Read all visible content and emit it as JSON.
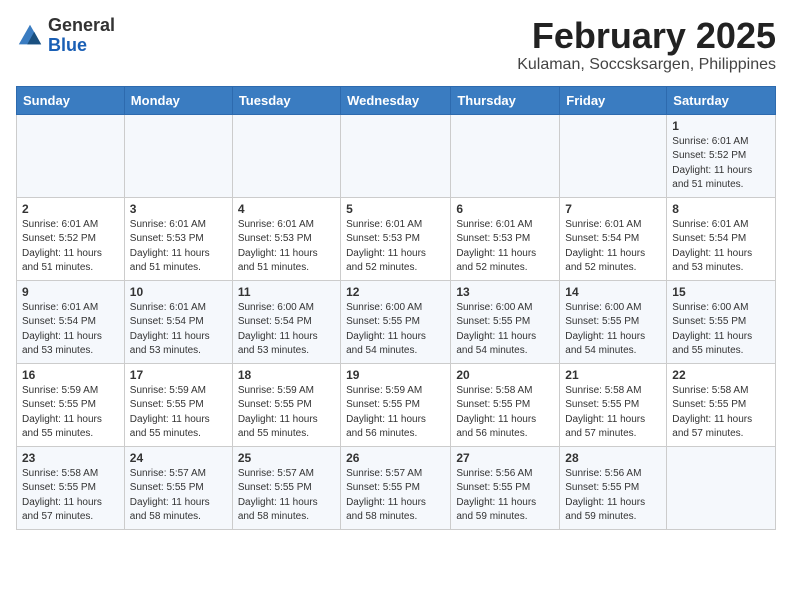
{
  "logo": {
    "general": "General",
    "blue": "Blue"
  },
  "title": "February 2025",
  "subtitle": "Kulaman, Soccsksargen, Philippines",
  "header_days": [
    "Sunday",
    "Monday",
    "Tuesday",
    "Wednesday",
    "Thursday",
    "Friday",
    "Saturday"
  ],
  "weeks": [
    [
      {
        "day": "",
        "info": ""
      },
      {
        "day": "",
        "info": ""
      },
      {
        "day": "",
        "info": ""
      },
      {
        "day": "",
        "info": ""
      },
      {
        "day": "",
        "info": ""
      },
      {
        "day": "",
        "info": ""
      },
      {
        "day": "1",
        "info": "Sunrise: 6:01 AM\nSunset: 5:52 PM\nDaylight: 11 hours and 51 minutes."
      }
    ],
    [
      {
        "day": "2",
        "info": "Sunrise: 6:01 AM\nSunset: 5:52 PM\nDaylight: 11 hours and 51 minutes."
      },
      {
        "day": "3",
        "info": "Sunrise: 6:01 AM\nSunset: 5:53 PM\nDaylight: 11 hours and 51 minutes."
      },
      {
        "day": "4",
        "info": "Sunrise: 6:01 AM\nSunset: 5:53 PM\nDaylight: 11 hours and 51 minutes."
      },
      {
        "day": "5",
        "info": "Sunrise: 6:01 AM\nSunset: 5:53 PM\nDaylight: 11 hours and 52 minutes."
      },
      {
        "day": "6",
        "info": "Sunrise: 6:01 AM\nSunset: 5:53 PM\nDaylight: 11 hours and 52 minutes."
      },
      {
        "day": "7",
        "info": "Sunrise: 6:01 AM\nSunset: 5:54 PM\nDaylight: 11 hours and 52 minutes."
      },
      {
        "day": "8",
        "info": "Sunrise: 6:01 AM\nSunset: 5:54 PM\nDaylight: 11 hours and 53 minutes."
      }
    ],
    [
      {
        "day": "9",
        "info": "Sunrise: 6:01 AM\nSunset: 5:54 PM\nDaylight: 11 hours and 53 minutes."
      },
      {
        "day": "10",
        "info": "Sunrise: 6:01 AM\nSunset: 5:54 PM\nDaylight: 11 hours and 53 minutes."
      },
      {
        "day": "11",
        "info": "Sunrise: 6:00 AM\nSunset: 5:54 PM\nDaylight: 11 hours and 53 minutes."
      },
      {
        "day": "12",
        "info": "Sunrise: 6:00 AM\nSunset: 5:55 PM\nDaylight: 11 hours and 54 minutes."
      },
      {
        "day": "13",
        "info": "Sunrise: 6:00 AM\nSunset: 5:55 PM\nDaylight: 11 hours and 54 minutes."
      },
      {
        "day": "14",
        "info": "Sunrise: 6:00 AM\nSunset: 5:55 PM\nDaylight: 11 hours and 54 minutes."
      },
      {
        "day": "15",
        "info": "Sunrise: 6:00 AM\nSunset: 5:55 PM\nDaylight: 11 hours and 55 minutes."
      }
    ],
    [
      {
        "day": "16",
        "info": "Sunrise: 5:59 AM\nSunset: 5:55 PM\nDaylight: 11 hours and 55 minutes."
      },
      {
        "day": "17",
        "info": "Sunrise: 5:59 AM\nSunset: 5:55 PM\nDaylight: 11 hours and 55 minutes."
      },
      {
        "day": "18",
        "info": "Sunrise: 5:59 AM\nSunset: 5:55 PM\nDaylight: 11 hours and 55 minutes."
      },
      {
        "day": "19",
        "info": "Sunrise: 5:59 AM\nSunset: 5:55 PM\nDaylight: 11 hours and 56 minutes."
      },
      {
        "day": "20",
        "info": "Sunrise: 5:58 AM\nSunset: 5:55 PM\nDaylight: 11 hours and 56 minutes."
      },
      {
        "day": "21",
        "info": "Sunrise: 5:58 AM\nSunset: 5:55 PM\nDaylight: 11 hours and 57 minutes."
      },
      {
        "day": "22",
        "info": "Sunrise: 5:58 AM\nSunset: 5:55 PM\nDaylight: 11 hours and 57 minutes."
      }
    ],
    [
      {
        "day": "23",
        "info": "Sunrise: 5:58 AM\nSunset: 5:55 PM\nDaylight: 11 hours and 57 minutes."
      },
      {
        "day": "24",
        "info": "Sunrise: 5:57 AM\nSunset: 5:55 PM\nDaylight: 11 hours and 58 minutes."
      },
      {
        "day": "25",
        "info": "Sunrise: 5:57 AM\nSunset: 5:55 PM\nDaylight: 11 hours and 58 minutes."
      },
      {
        "day": "26",
        "info": "Sunrise: 5:57 AM\nSunset: 5:55 PM\nDaylight: 11 hours and 58 minutes."
      },
      {
        "day": "27",
        "info": "Sunrise: 5:56 AM\nSunset: 5:55 PM\nDaylight: 11 hours and 59 minutes."
      },
      {
        "day": "28",
        "info": "Sunrise: 5:56 AM\nSunset: 5:55 PM\nDaylight: 11 hours and 59 minutes."
      },
      {
        "day": "",
        "info": ""
      }
    ]
  ]
}
